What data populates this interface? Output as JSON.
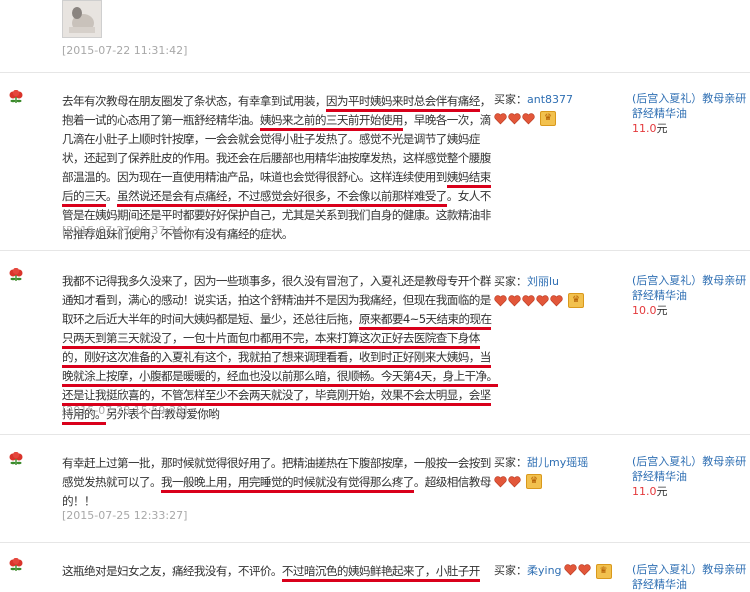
{
  "top_review": {
    "date": "[2015-07-22 11:31:42]"
  },
  "reviews": [
    {
      "content": [
        {
          "t": "去年有次教母在朋友圈发了条状态，有幸拿到试用装，",
          "u": false
        },
        {
          "t": "因为平时姨妈来时总会伴有痛经",
          "u": true
        },
        {
          "t": "，抱着一试的心态用了第一瓶舒经精华油。",
          "u": false
        },
        {
          "t": "姨妈来之前的三天前开始使用",
          "u": true
        },
        {
          "t": "，早晚各一次，滴几滴在小肚子上顺时针按摩，一会会就会觉得小肚子发热了。感觉不光是调节了姨妈症状，还起到了保养肚皮的作用。我还会在后腰部也用精华油按摩发热，这样感觉整个腰腹部温温的。因为现在一直使用精油产品，味道也会觉得很舒心。这样连续使用到",
          "u": false
        },
        {
          "t": "姨妈结束后的三天",
          "u": true
        },
        {
          "t": "。",
          "u": false
        },
        {
          "t": "虽然说还是会有点痛经，不过感觉会好很多，不会像以前那样难受了",
          "u": true
        },
        {
          "t": "。女人不管是在姨妈期间还是平时都要好好保护自己，尤其是关系到我们自身的健康。这款精油非常推荐姐妹们使用，不管你有没有痛经的症状。",
          "u": false
        }
      ],
      "date": "[2015-07-27 09:37:34]",
      "buyer_label": "买家：",
      "buyer_name": "ant8377",
      "hearts": 3,
      "product": "(后宫入夏礼）教母亲研舒经精华油",
      "price": "11.0",
      "price_unit": "元"
    },
    {
      "content": [
        {
          "t": "我都不记得我多久没来了，因为一些琐事多，很久没有冒泡了，入夏礼还是教母专开个群通知才看到，满心的感动！说实话，拍这个舒精油并不是因为我痛经，但现在我面临的是取环之后近大半年的时间大姨妈都是短、量少，还总往后拖，",
          "u": false
        },
        {
          "t": "原来都要4~5天结束的现在只两天到第三天就没了",
          "u": true
        },
        {
          "t": "，一包十片面包巾都用不完，本来打算这次正好去医院查下身体的，刚好这次准备的入夏礼有这个，我就拍了想来调理看看，收到时正好刚来大姨妈，当晚就涂上按摩，小腹都是暖暖的，经血也没以前那么暗，很顺畅。今天第4天，身上干净。还是让我挺欣喜的，不管怎样至少不会两天就没了，毕竟刚开始，效果不会太明显，会坚持用的。",
          "u": true
        },
        {
          "t": "另外表个白:教母爱你哟",
          "u": false
        }
      ],
      "date": "[2015-07-28 15:59:30]",
      "buyer_label": "买家：",
      "buyer_name": "刘丽lu",
      "hearts": 5,
      "product": "(后宫入夏礼）教母亲研舒经精华油",
      "price": "10.0",
      "price_unit": "元"
    },
    {
      "content": [
        {
          "t": "有幸赶上过第一批，那时候就觉得很好用了。把精油搓热在下腹部按摩，一般按一会按到感觉发热就可以了。",
          "u": false
        },
        {
          "t": "我一般晚上用，用完睡觉的时候就没有觉得那么疼了",
          "u": true
        },
        {
          "t": "。超级相信教母的！！",
          "u": false
        }
      ],
      "date": "[2015-07-25 12:33:27]",
      "buyer_label": "买家：",
      "buyer_name": "甜儿my瑶瑶",
      "hearts": 2,
      "product": "(后宫入夏礼）教母亲研舒经精华油",
      "price": "11.0",
      "price_unit": "元"
    },
    {
      "content": [
        {
          "t": "这瓶绝对是妇女之友，痛经我没有，不评价。",
          "u": false
        },
        {
          "t": "不过暗沉色的姨妈鲜艳起来了，小肚子开",
          "u": true
        }
      ],
      "buyer_label": "买家：",
      "buyer_name": "柔ying",
      "hearts": 2,
      "product": "(后宫入夏礼）教母亲研舒经精华油"
    }
  ],
  "icons": {
    "flower": "rose-flower-icon",
    "heart": "heart-level-icon",
    "vip": "vip-badge-icon"
  },
  "colors": {
    "link": "#2f6fb3",
    "price": "#e4393c",
    "underline": "#d9001b",
    "date": "#a8a8a8",
    "heart": "#e2573a"
  }
}
